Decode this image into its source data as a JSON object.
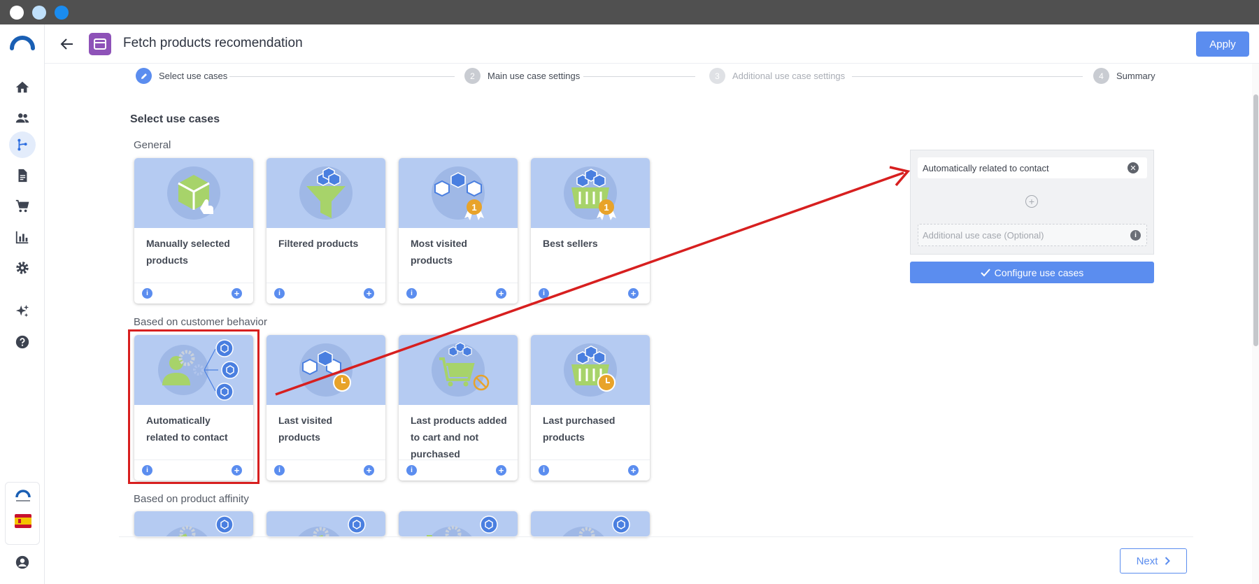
{
  "header": {
    "title": "Fetch products recomendation",
    "apply_label": "Apply"
  },
  "stepper": [
    {
      "num": "",
      "label": "Select use cases"
    },
    {
      "num": "2",
      "label": "Main use case settings"
    },
    {
      "num": "3",
      "label": "Additional use case settings"
    },
    {
      "num": "4",
      "label": "Summary"
    }
  ],
  "main": {
    "section_title": "Select use cases",
    "groups": [
      {
        "label": "General",
        "cards": [
          {
            "title": "Manually selected products"
          },
          {
            "title": "Filtered products"
          },
          {
            "title": "Most visited products"
          },
          {
            "title": "Best sellers"
          }
        ]
      },
      {
        "label": "Based on customer behavior",
        "cards": [
          {
            "title": "Automatically related to contact"
          },
          {
            "title": "Last visited products"
          },
          {
            "title": "Last products added to cart and not purchased"
          },
          {
            "title": "Last purchased products"
          }
        ]
      },
      {
        "label": "Based on product affinity",
        "cards": []
      }
    ]
  },
  "panel": {
    "selected_use_case": "Automatically related to contact",
    "additional_placeholder": "Additional use case (Optional)",
    "configure_label": "Configure use cases"
  },
  "footer": {
    "next_label": "Next"
  },
  "colors": {
    "accent": "#5b8def",
    "card_image_bg": "#b5cbf2",
    "highlight": "#d71f1f",
    "header_icon": "#8e52b8"
  },
  "sidebar": {
    "icons": [
      "home-icon",
      "contacts-icon",
      "automation-icon",
      "documents-icon",
      "cart-icon",
      "analytics-icon",
      "settings-icon",
      "ai-sparkle-icon",
      "help-icon"
    ],
    "brand_label": "CONNECTIF",
    "language_flag": "spain-flag-icon",
    "profile_icon": "user-icon"
  }
}
